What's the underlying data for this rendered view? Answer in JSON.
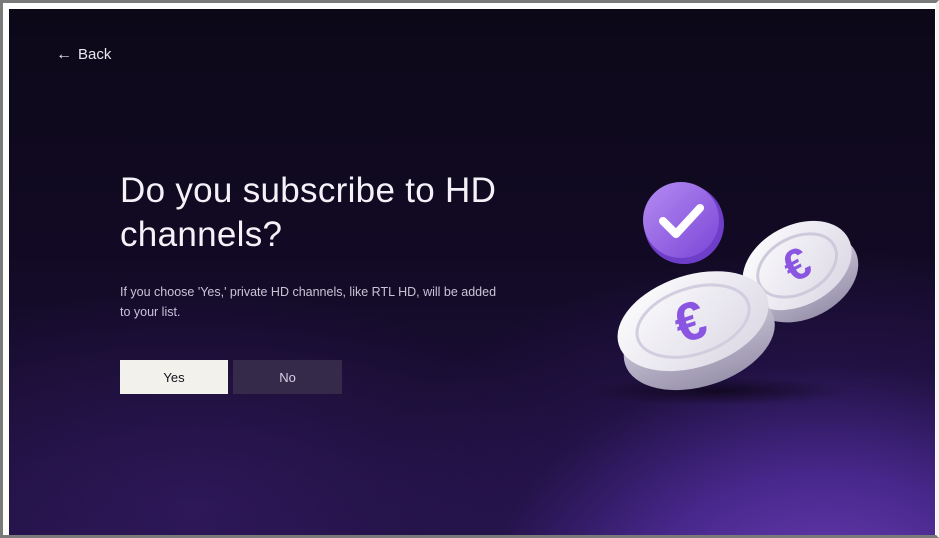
{
  "nav": {
    "back_label": "Back"
  },
  "question": {
    "title": "Do you subscribe to HD channels?",
    "description": "If you choose 'Yes,' private HD channels, like RTL HD, will be added to your list."
  },
  "buttons": {
    "yes_label": "Yes",
    "no_label": "No"
  },
  "illustration": {
    "icons": [
      "checkmark-badge-icon",
      "euro-coin-icon",
      "euro-coin-icon"
    ],
    "currency_symbol": "€"
  },
  "colors": {
    "background_dark": "#0c0818",
    "background_purple": "#6a3fb8",
    "accent_purple": "#8a55e0",
    "yes_button_bg": "#f3f1ec",
    "no_button_bg": "#352a4a"
  }
}
